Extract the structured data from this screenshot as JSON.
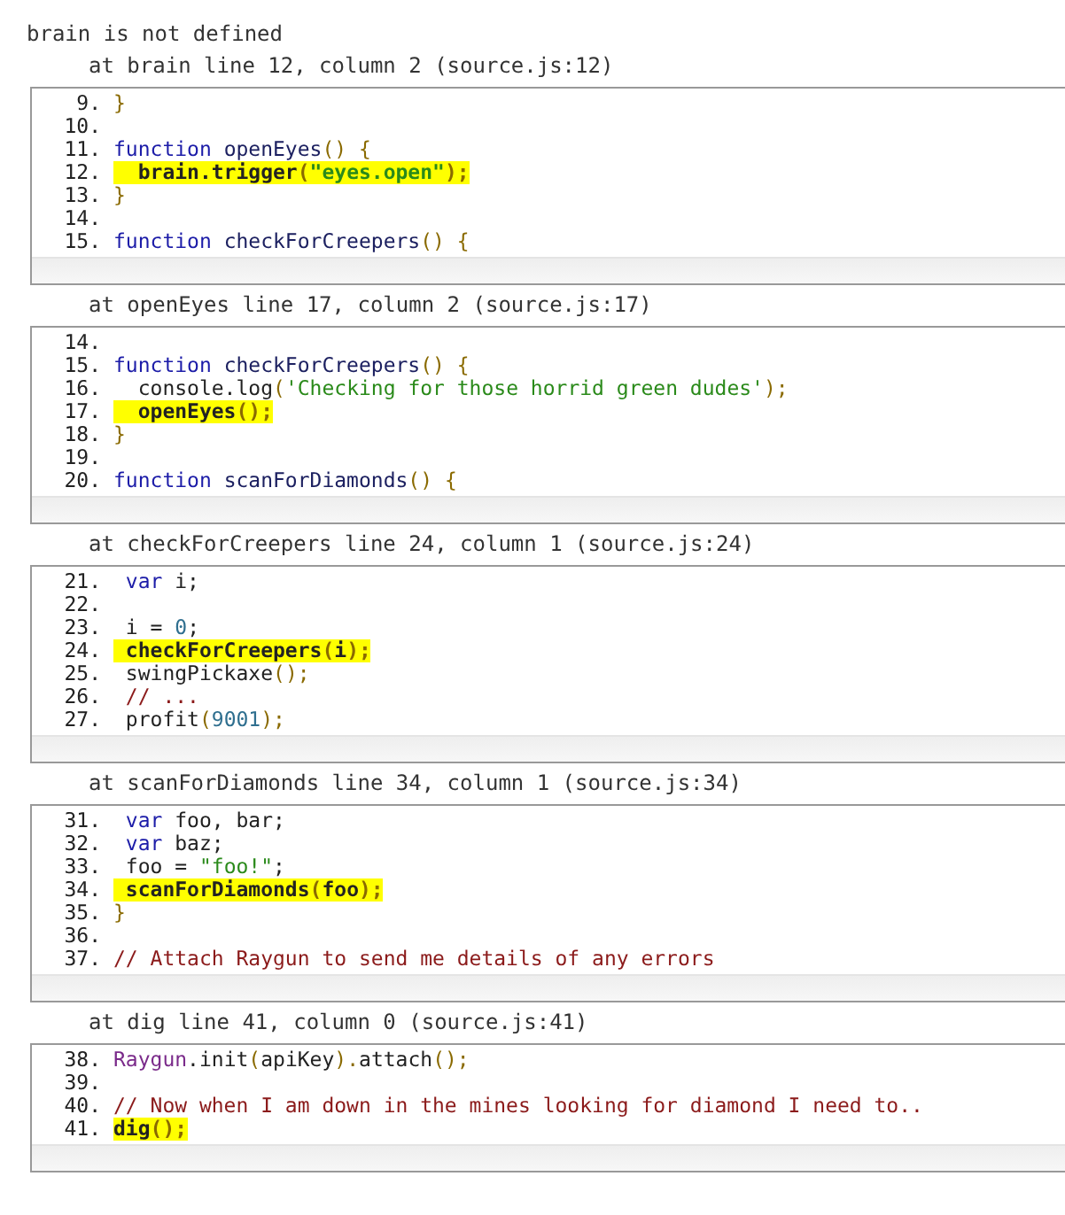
{
  "error": "brain is not defined",
  "frames": [
    {
      "heading": "at brain line 12, column 2 (source.js:12)",
      "lines": [
        {
          "number": "9.",
          "highlighted": false,
          "tokens": [
            {
              "kind": "punc",
              "text": "}"
            }
          ]
        },
        {
          "number": "10.",
          "highlighted": false
        },
        {
          "number": "11.",
          "highlighted": false,
          "tokens": [
            {
              "kind": "keyword",
              "text": "function"
            },
            {
              "kind": "name",
              "text": " openEyes"
            },
            {
              "kind": "punc",
              "text": "() {"
            }
          ]
        },
        {
          "number": "12.",
          "highlighted": true,
          "tokens": [
            {
              "kind": "plain",
              "text": "  brain.trigger"
            },
            {
              "kind": "punc",
              "text": "("
            },
            {
              "kind": "string",
              "text": "\"eyes.open\""
            },
            {
              "kind": "punc",
              "text": ");"
            }
          ]
        },
        {
          "number": "13.",
          "highlighted": false,
          "tokens": [
            {
              "kind": "punc",
              "text": "}"
            }
          ]
        },
        {
          "number": "14.",
          "highlighted": false
        },
        {
          "number": "15.",
          "highlighted": false,
          "tokens": [
            {
              "kind": "keyword",
              "text": "function"
            },
            {
              "kind": "name",
              "text": " checkForCreepers"
            },
            {
              "kind": "punc",
              "text": "() {"
            }
          ]
        }
      ]
    },
    {
      "heading": "at openEyes line 17, column 2 (source.js:17)",
      "lines": [
        {
          "number": "14.",
          "highlighted": false
        },
        {
          "number": "15.",
          "highlighted": false,
          "tokens": [
            {
              "kind": "keyword",
              "text": "function"
            },
            {
              "kind": "name",
              "text": " checkForCreepers"
            },
            {
              "kind": "punc",
              "text": "() {"
            }
          ]
        },
        {
          "number": "16.",
          "highlighted": false,
          "tokens": [
            {
              "kind": "plain",
              "text": "  console.log"
            },
            {
              "kind": "punc",
              "text": "("
            },
            {
              "kind": "string",
              "text": "'Checking for those horrid green dudes'"
            },
            {
              "kind": "punc",
              "text": ");"
            }
          ]
        },
        {
          "number": "17.",
          "highlighted": true,
          "tokens": [
            {
              "kind": "plain",
              "text": "  openEyes"
            },
            {
              "kind": "punc",
              "text": "();"
            }
          ]
        },
        {
          "number": "18.",
          "highlighted": false,
          "tokens": [
            {
              "kind": "punc",
              "text": "}"
            }
          ]
        },
        {
          "number": "19.",
          "highlighted": false
        },
        {
          "number": "20.",
          "highlighted": false,
          "tokens": [
            {
              "kind": "keyword",
              "text": "function"
            },
            {
              "kind": "name",
              "text": " scanForDiamonds"
            },
            {
              "kind": "punc",
              "text": "() {"
            }
          ]
        }
      ]
    },
    {
      "heading": "at checkForCreepers line 24, column 1 (source.js:24)",
      "lines": [
        {
          "number": "21.",
          "highlighted": false,
          "tokens": [
            {
              "kind": "keyword",
              "text": " var"
            },
            {
              "kind": "plain",
              "text": " i;"
            }
          ]
        },
        {
          "number": "22.",
          "highlighted": false
        },
        {
          "number": "23.",
          "highlighted": false,
          "tokens": [
            {
              "kind": "plain",
              "text": " i = "
            },
            {
              "kind": "number",
              "text": "0"
            },
            {
              "kind": "plain",
              "text": ";"
            }
          ]
        },
        {
          "number": "24.",
          "highlighted": true,
          "tokens": [
            {
              "kind": "plain",
              "text": " checkForCreepers"
            },
            {
              "kind": "punc",
              "text": "("
            },
            {
              "kind": "plain",
              "text": "i"
            },
            {
              "kind": "punc",
              "text": ");"
            }
          ]
        },
        {
          "number": "25.",
          "highlighted": false,
          "tokens": [
            {
              "kind": "plain",
              "text": " swingPickaxe"
            },
            {
              "kind": "punc",
              "text": "();"
            }
          ]
        },
        {
          "number": "26.",
          "highlighted": false,
          "tokens": [
            {
              "kind": "comment",
              "text": " // ..."
            }
          ]
        },
        {
          "number": "27.",
          "highlighted": false,
          "tokens": [
            {
              "kind": "plain",
              "text": " profit"
            },
            {
              "kind": "punc",
              "text": "("
            },
            {
              "kind": "number",
              "text": "9001"
            },
            {
              "kind": "punc",
              "text": ");"
            }
          ]
        }
      ]
    },
    {
      "heading": "at scanForDiamonds line 34, column 1 (source.js:34)",
      "lines": [
        {
          "number": "31.",
          "highlighted": false,
          "tokens": [
            {
              "kind": "keyword",
              "text": " var"
            },
            {
              "kind": "plain",
              "text": " foo, bar;"
            }
          ]
        },
        {
          "number": "32.",
          "highlighted": false,
          "tokens": [
            {
              "kind": "keyword",
              "text": " var"
            },
            {
              "kind": "plain",
              "text": " baz;"
            }
          ]
        },
        {
          "number": "33.",
          "highlighted": false,
          "tokens": [
            {
              "kind": "plain",
              "text": " foo = "
            },
            {
              "kind": "string",
              "text": "\"foo!\""
            },
            {
              "kind": "plain",
              "text": ";"
            }
          ]
        },
        {
          "number": "34.",
          "highlighted": true,
          "tokens": [
            {
              "kind": "plain",
              "text": " scanForDiamonds"
            },
            {
              "kind": "punc",
              "text": "("
            },
            {
              "kind": "plain",
              "text": "foo"
            },
            {
              "kind": "punc",
              "text": ");"
            }
          ]
        },
        {
          "number": "35.",
          "highlighted": false,
          "tokens": [
            {
              "kind": "punc",
              "text": "}"
            }
          ]
        },
        {
          "number": "36.",
          "highlighted": false
        },
        {
          "number": "37.",
          "highlighted": false,
          "tokens": [
            {
              "kind": "comment",
              "text": "// Attach Raygun to send me details of any errors"
            }
          ]
        }
      ]
    },
    {
      "heading": "at dig line 41, column 0 (source.js:41)",
      "lines": [
        {
          "number": "38.",
          "highlighted": false,
          "tokens": [
            {
              "kind": "object",
              "text": "Raygun"
            },
            {
              "kind": "plain",
              "text": ".init"
            },
            {
              "kind": "punc",
              "text": "("
            },
            {
              "kind": "plain",
              "text": "apiKey"
            },
            {
              "kind": "punc",
              "text": ")."
            },
            {
              "kind": "plain",
              "text": "attach"
            },
            {
              "kind": "punc",
              "text": "();"
            }
          ]
        },
        {
          "number": "39.",
          "highlighted": false
        },
        {
          "number": "40.",
          "highlighted": false,
          "tokens": [
            {
              "kind": "comment",
              "text": "// Now when I am down in the mines looking for diamond I need to.."
            }
          ]
        },
        {
          "number": "41.",
          "highlighted": true,
          "tokens": [
            {
              "kind": "plain",
              "text": "dig"
            },
            {
              "kind": "punc",
              "text": "();"
            }
          ]
        }
      ]
    }
  ]
}
